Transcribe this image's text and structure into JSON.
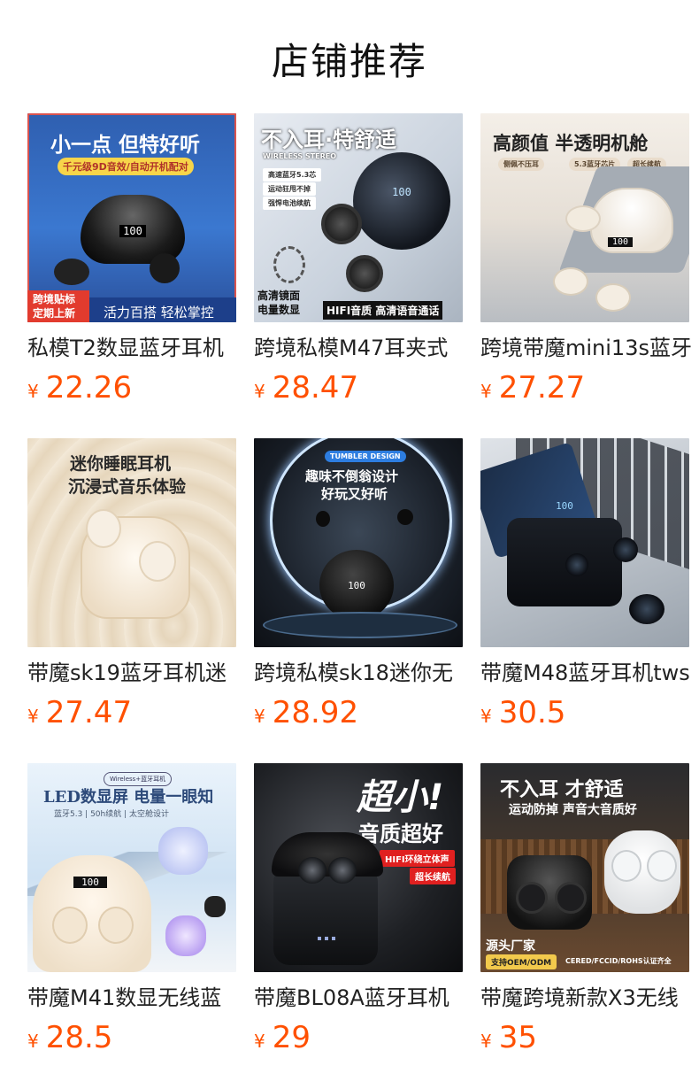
{
  "page_title": "店铺推荐",
  "currency": "¥",
  "products": [
    {
      "name": "私模T2数显蓝牙耳机",
      "price": "22.26",
      "img": {
        "headline": "小一点 但特好听",
        "tag": "千元级9D音效/自动开机配对",
        "corner": "跨境贴标\n定期上新",
        "footer": "活力百搭 轻松掌控",
        "display": "100"
      }
    },
    {
      "name": "跨境私模M47耳夹式",
      "price": "28.47",
      "img": {
        "headline": "不入耳·特舒适",
        "sub": "WIRELESS STEREO",
        "features": [
          "高速蓝牙5.3芯",
          "运动狂甩不掉",
          "强悍电池续航"
        ],
        "corner": "高清镜面\n电量数显",
        "footer": "HIFI音质 高清语音通话",
        "display": "100"
      }
    },
    {
      "name": "跨境带魔mini13s蓝牙",
      "price": "27.27",
      "img": {
        "headline": "高颜值 半透明机舱",
        "features": [
          "侧佩不压耳",
          "5.3蓝牙芯片",
          "超长续航"
        ],
        "display": "100"
      }
    },
    {
      "name": "带魔sk19蓝牙耳机迷",
      "price": "27.47",
      "img": {
        "headline": "迷你睡眠耳机",
        "sub": "沉浸式音乐体验"
      }
    },
    {
      "name": "跨境私模sk18迷你无",
      "price": "28.92",
      "img": {
        "tag": "TUMBLER DESIGN",
        "headline": "趣味不倒翁设计",
        "sub": "好玩又好听",
        "display": "100"
      }
    },
    {
      "name": "带魔M48蓝牙耳机tws",
      "price": "30.5",
      "img": {
        "display": "100"
      }
    },
    {
      "name": "带魔M41数显无线蓝",
      "price": "28.5",
      "img": {
        "tag": "Wireless+蓝牙耳机",
        "headline": "LED数显屏 电量一眼知",
        "sub": "蓝牙5.3 | 50h续航 | 太空舱设计",
        "display": "100"
      }
    },
    {
      "name": "带魔BL08A蓝牙耳机",
      "price": "29",
      "img": {
        "headline": "超小!",
        "sub": "音质超好",
        "features": [
          "HIFI环绕立体声",
          "超长续航"
        ]
      }
    },
    {
      "name": "带魔跨境新款X3无线",
      "price": "35",
      "img": {
        "headline": "不入耳 才舒适",
        "sub": "运动防掉 声音大音质好",
        "corner": "源头厂家",
        "corner_tag": "支持OEM/ODM",
        "footer": "CERED/FCCID/ROHS认证齐全"
      }
    }
  ]
}
